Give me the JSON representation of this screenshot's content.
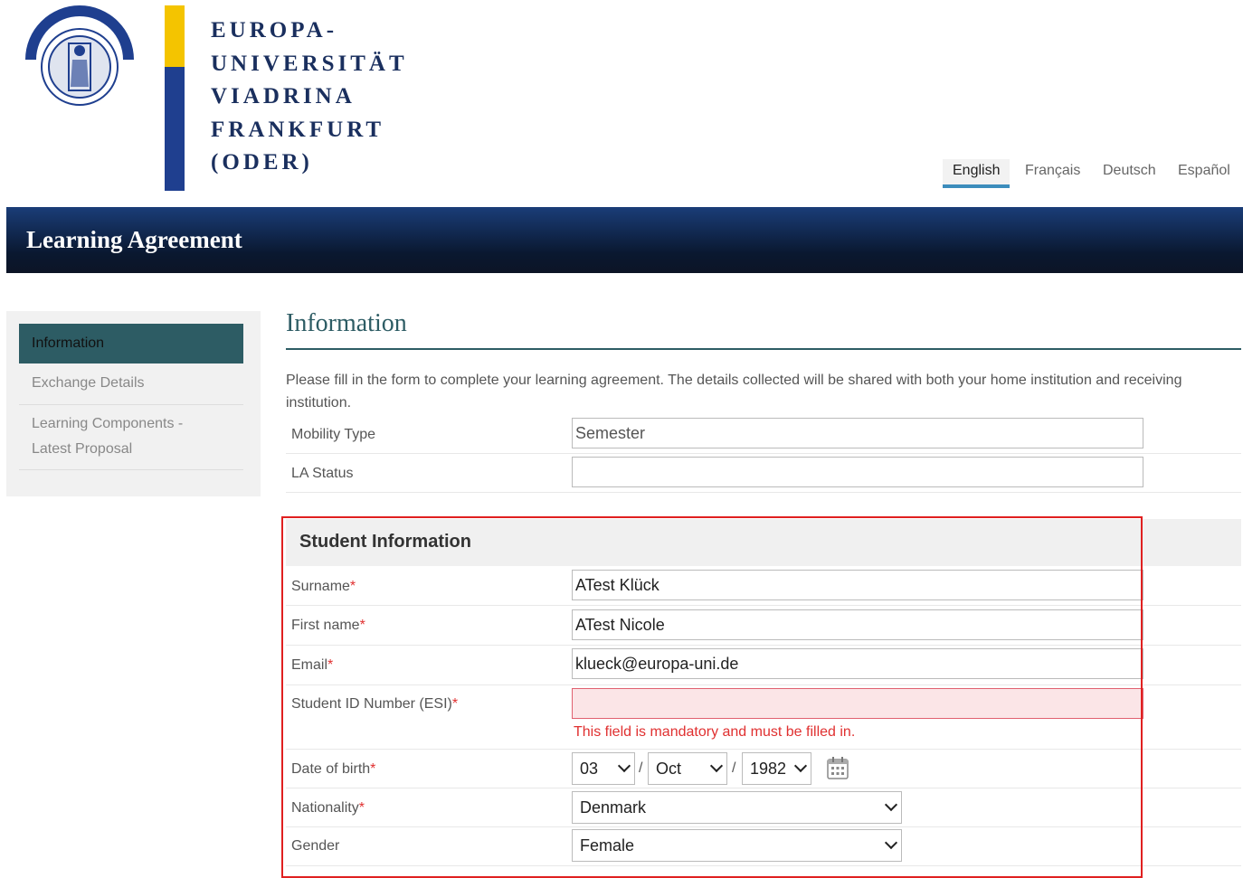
{
  "header": {
    "logo_lines": [
      "EUROPA-",
      "UNIVERSITÄT",
      "VIADRINA",
      "FRANKFURT",
      "(ODER)"
    ],
    "seal_text": "EUROPA UNIVERSITÄT VIADRINA"
  },
  "languages": [
    {
      "label": "English",
      "active": true
    },
    {
      "label": "Français",
      "active": false
    },
    {
      "label": "Deutsch",
      "active": false
    },
    {
      "label": "Español",
      "active": false
    }
  ],
  "banner": {
    "title": "Learning Agreement"
  },
  "sidebar": {
    "items": [
      {
        "label": "Information"
      },
      {
        "label": "Exchange Details"
      },
      {
        "label": "Learning Components -"
      },
      {
        "label": "Latest Proposal"
      }
    ]
  },
  "main": {
    "title": "Information",
    "intro": "Please fill in the form to complete your learning agreement. The details collected will be shared with both your home institution and receiving institution.",
    "mobility_type": {
      "label": "Mobility Type",
      "value": "Semester"
    },
    "la_status": {
      "label": "LA Status",
      "value": ""
    }
  },
  "student": {
    "section_title": "Student Information",
    "required_mark": "*",
    "surname": {
      "label": "Surname",
      "value": "ATest Klück"
    },
    "first_name": {
      "label": "First name",
      "value": "ATest Nicole"
    },
    "email": {
      "label": "Email",
      "value": "klueck@europa-uni.de"
    },
    "student_id": {
      "label": "Student ID Number (ESI)",
      "value": "",
      "error": "This field is mandatory and must be filled in."
    },
    "dob": {
      "label": "Date of birth",
      "day": "03",
      "month": "Oct",
      "year": "1982",
      "separator": "/"
    },
    "nationality": {
      "label": "Nationality",
      "value": "Denmark"
    },
    "gender": {
      "label": "Gender",
      "value": "Female"
    }
  },
  "colors": {
    "accent": "#2d5c64",
    "tab_underline": "#3c8dbc",
    "error": "#e03030",
    "banner": "#0a1830"
  }
}
